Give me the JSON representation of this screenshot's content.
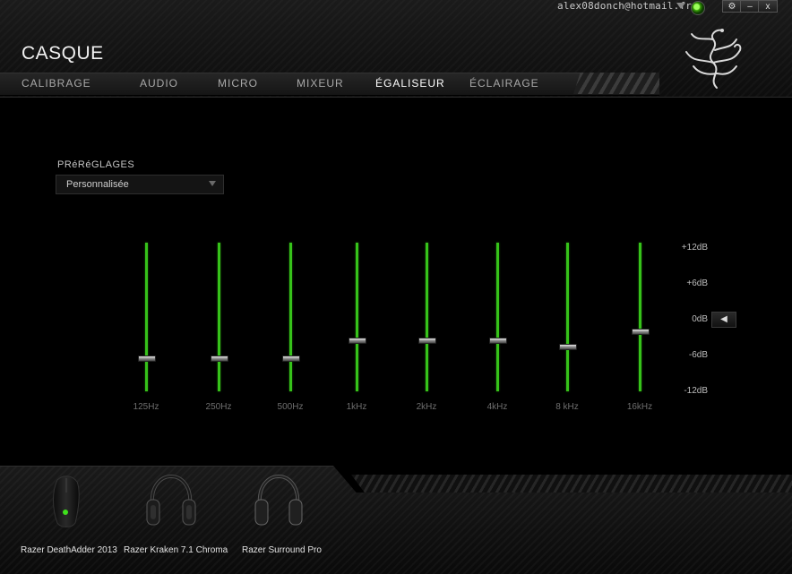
{
  "window": {
    "account_email": "alex08donch@hotmail.fr",
    "settings_label": "⚙",
    "minimize_label": "–",
    "close_label": "x"
  },
  "header": {
    "title": "CASQUE",
    "tabs": [
      {
        "label": "CALIBRAGE",
        "active": false
      },
      {
        "label": "AUDIO",
        "active": false
      },
      {
        "label": "MICRO",
        "active": false
      },
      {
        "label": "MIXEUR",
        "active": false
      },
      {
        "label": "ÉGALISEUR",
        "active": true
      },
      {
        "label": "ÉCLAIRAGE",
        "active": false
      }
    ]
  },
  "presets": {
    "label": "PRéRéGLAGES",
    "selected": "Personnalisée"
  },
  "equalizer": {
    "db_scale": [
      "+12dB",
      "+6dB",
      "0dB",
      "-6dB",
      "-12dB"
    ],
    "reset_label": "◀",
    "bands": [
      {
        "label": "125Hz",
        "gain_db": -6.5
      },
      {
        "label": "250Hz",
        "gain_db": -6.5
      },
      {
        "label": "500Hz",
        "gain_db": -6.5
      },
      {
        "label": "1kHz",
        "gain_db": -3.5
      },
      {
        "label": "2kHz",
        "gain_db": -3.5
      },
      {
        "label": "4kHz",
        "gain_db": -3.5
      },
      {
        "label": "8 kHz",
        "gain_db": -4.5
      },
      {
        "label": "16kHz",
        "gain_db": -2
      }
    ],
    "accent_color": "#36c21a"
  },
  "devices": [
    {
      "name": "Razer DeathAdder 2013",
      "icon": "mouse-icon"
    },
    {
      "name": "Razer Kraken 7.1 Chroma",
      "icon": "headset-icon"
    },
    {
      "name": "Razer Surround Pro",
      "icon": "headset-icon"
    }
  ]
}
